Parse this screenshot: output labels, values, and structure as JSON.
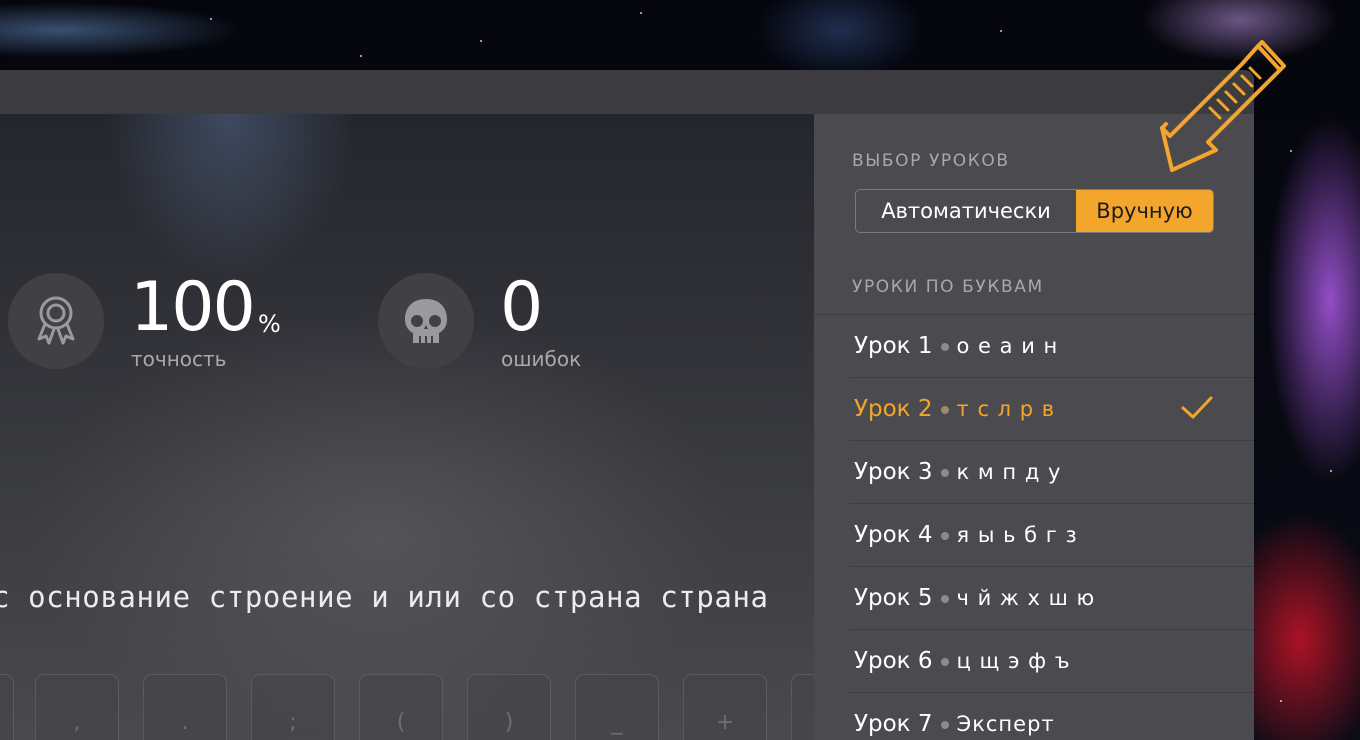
{
  "stats": {
    "accuracy": {
      "icon": "award-ribbon-icon",
      "value": "100",
      "unit": "%",
      "label": "точность"
    },
    "errors": {
      "icon": "skull-icon",
      "value": "0",
      "label": "ошибок"
    }
  },
  "typing": {
    "text": "с основание строение и или со страна страна"
  },
  "keyboard": {
    "keys": [
      "",
      ",",
      ".",
      ";",
      "(",
      ")",
      "_",
      "+",
      ""
    ]
  },
  "panel": {
    "lesson_selection_title": "ВЫБОР УРОКОВ",
    "mode_auto_label": "Автоматически",
    "mode_manual_label": "Вручную",
    "selected_mode": "Вручную",
    "lessons_by_letters_title": "УРОКИ ПО БУКВАМ",
    "lessons": [
      {
        "name": "Урок 1",
        "letters": "о е а и н",
        "selected": false
      },
      {
        "name": "Урок 2",
        "letters": "т с л р в",
        "selected": true
      },
      {
        "name": "Урок 3",
        "letters": "к м п д у",
        "selected": false
      },
      {
        "name": "Урок 4",
        "letters": "я ы ь б г з",
        "selected": false
      },
      {
        "name": "Урок 5",
        "letters": "ч й ж х ш ю",
        "selected": false
      },
      {
        "name": "Урок 6",
        "letters": "ц щ э ф ъ",
        "selected": false
      },
      {
        "name": "Урок 7",
        "letters": "Эксперт",
        "selected": false
      }
    ]
  },
  "colors": {
    "accent": "#f4a52b",
    "panel_bg": "#4b4b4f",
    "window_bg": "#3b3b3f"
  }
}
